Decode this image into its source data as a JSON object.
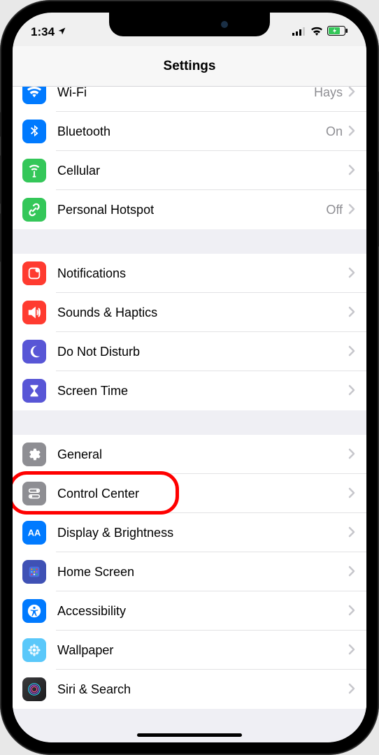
{
  "status": {
    "time": "1:34",
    "location_icon": "location-arrow"
  },
  "header": {
    "title": "Settings"
  },
  "groups": [
    {
      "rows": [
        {
          "id": "wifi",
          "label": "Wi-Fi",
          "value": "Hays",
          "icon": "wifi-icon",
          "icon_class": "ic-wifi",
          "svg": "wifi"
        },
        {
          "id": "bluetooth",
          "label": "Bluetooth",
          "value": "On",
          "icon": "bluetooth-icon",
          "icon_class": "ic-bluetooth",
          "svg": "bluetooth"
        },
        {
          "id": "cellular",
          "label": "Cellular",
          "value": "",
          "icon": "cellular-icon",
          "icon_class": "ic-cellular",
          "svg": "cellular"
        },
        {
          "id": "hotspot",
          "label": "Personal Hotspot",
          "value": "Off",
          "icon": "hotspot-icon",
          "icon_class": "ic-hotspot",
          "svg": "link"
        }
      ]
    },
    {
      "rows": [
        {
          "id": "notifications",
          "label": "Notifications",
          "value": "",
          "icon": "notifications-icon",
          "icon_class": "ic-notif",
          "svg": "notif"
        },
        {
          "id": "sounds",
          "label": "Sounds & Haptics",
          "value": "",
          "icon": "sounds-icon",
          "icon_class": "ic-sounds",
          "svg": "sound"
        },
        {
          "id": "dnd",
          "label": "Do Not Disturb",
          "value": "",
          "icon": "dnd-icon",
          "icon_class": "ic-dnd",
          "svg": "moon"
        },
        {
          "id": "screentime",
          "label": "Screen Time",
          "value": "",
          "icon": "screentime-icon",
          "icon_class": "ic-screentime",
          "svg": "hourglass"
        }
      ]
    },
    {
      "rows": [
        {
          "id": "general",
          "label": "General",
          "value": "",
          "icon": "general-icon",
          "icon_class": "ic-general",
          "svg": "gear"
        },
        {
          "id": "control",
          "label": "Control Center",
          "value": "",
          "icon": "control-icon",
          "icon_class": "ic-control",
          "svg": "switch",
          "highlight": true
        },
        {
          "id": "display",
          "label": "Display & Brightness",
          "value": "",
          "icon": "display-icon",
          "icon_class": "ic-display",
          "svg": "aa"
        },
        {
          "id": "homescreen",
          "label": "Home Screen",
          "value": "",
          "icon": "homescreen-icon",
          "icon_class": "ic-home",
          "svg": "grid"
        },
        {
          "id": "accessibility",
          "label": "Accessibility",
          "value": "",
          "icon": "accessibility-icon",
          "icon_class": "ic-access",
          "svg": "access"
        },
        {
          "id": "wallpaper",
          "label": "Wallpaper",
          "value": "",
          "icon": "wallpaper-icon",
          "icon_class": "ic-wallpaper",
          "svg": "flower"
        },
        {
          "id": "siri",
          "label": "Siri & Search",
          "value": "",
          "icon": "siri-icon",
          "icon_class": "ic-siri",
          "svg": "siri"
        }
      ]
    }
  ]
}
